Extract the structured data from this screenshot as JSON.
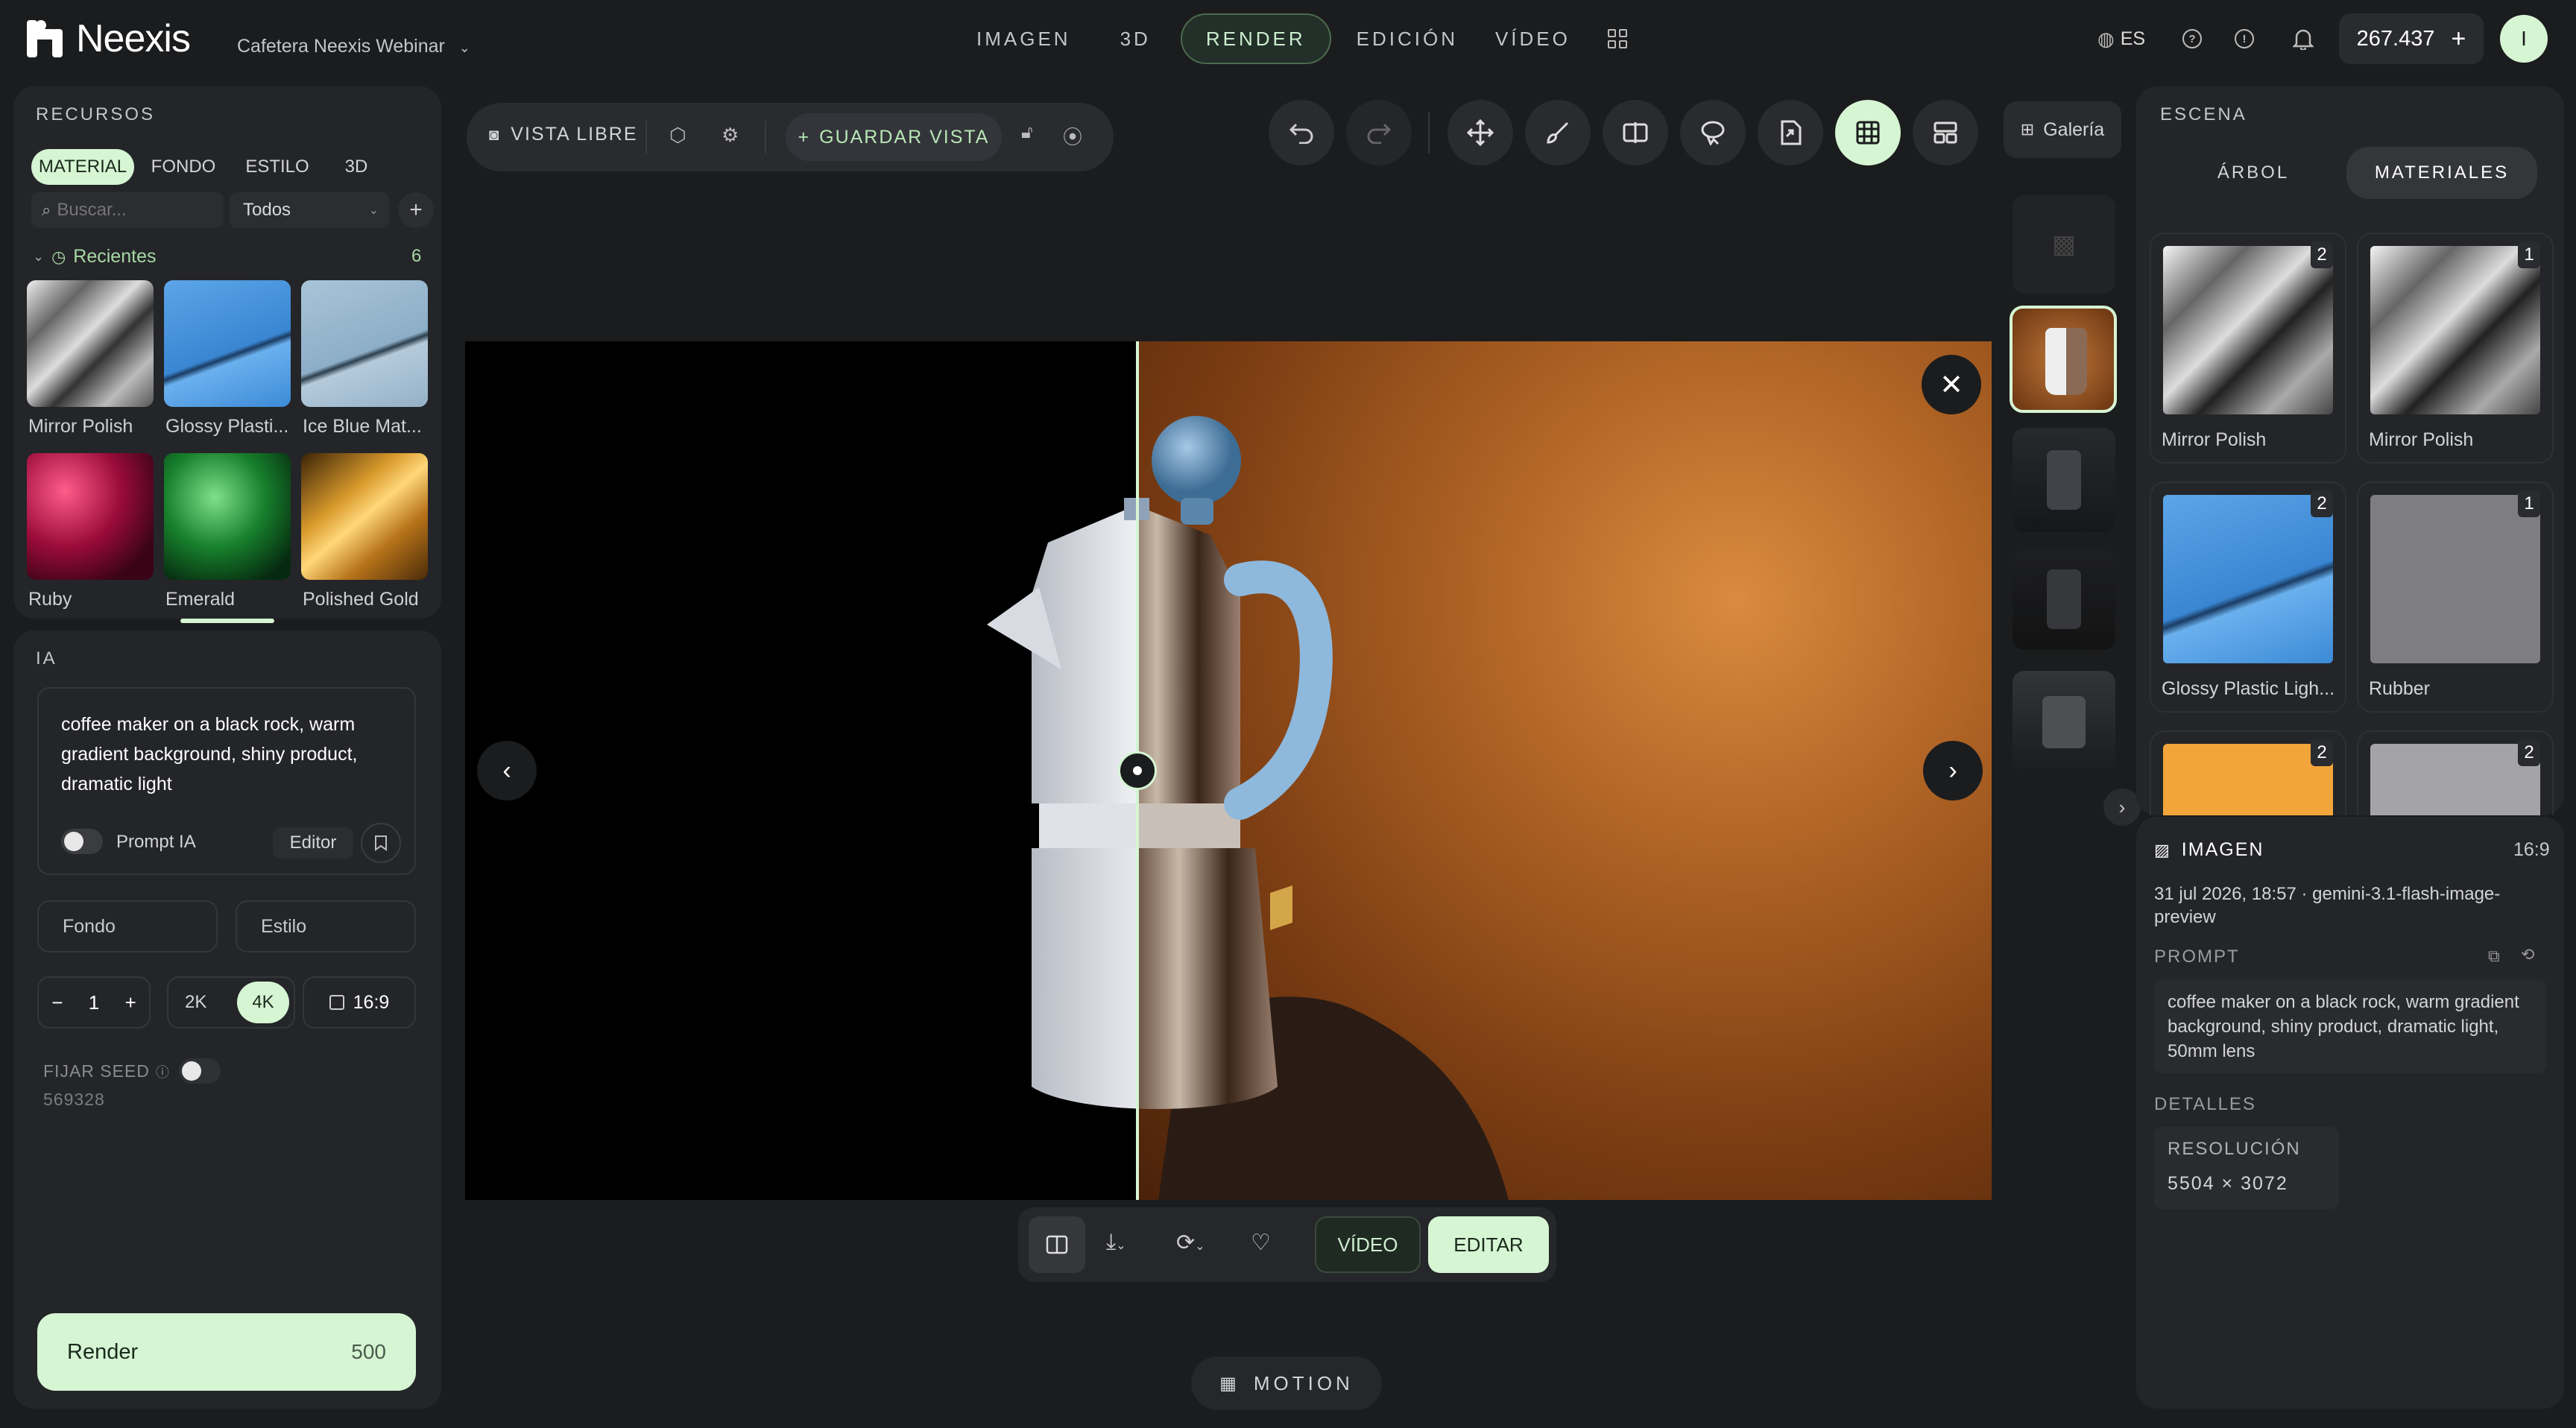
{
  "topbar": {
    "brand": "Neexis",
    "project": "Cafetera Neexis Webinar",
    "nav": [
      "IMAGEN",
      "3D",
      "RENDER",
      "EDICIÓN",
      "VÍDEO"
    ],
    "nav_active": "RENDER",
    "language": "ES",
    "credits": "267.437",
    "avatar_initial": "I"
  },
  "resources": {
    "title": "RECURSOS",
    "tabs": [
      "MATERIAL",
      "FONDO",
      "ESTILO",
      "3D"
    ],
    "search_placeholder": "Buscar...",
    "filter": "Todos",
    "section": "Recientes",
    "section_count": "6",
    "materials": [
      "Mirror Polish",
      "Glossy Plasti...",
      "Ice Blue Mat...",
      "Ruby",
      "Emerald",
      "Polished Gold"
    ]
  },
  "ai": {
    "title": "IA",
    "prompt": "coffee maker on a black rock, warm gradient background, shiny product, dramatic light",
    "prompt_toggle_label": "Prompt IA",
    "editor_label": "Editor",
    "fondo_label": "Fondo",
    "estilo_label": "Estilo",
    "count": "1",
    "res_options": [
      "2K",
      "4K"
    ],
    "res_active": "4K",
    "ratio": "16:9",
    "seed_label": "FIJAR SEED",
    "seed_value": "569328",
    "render_label": "Render",
    "render_cost": "500"
  },
  "viewer": {
    "view_label": "VISTA LIBRE",
    "save_view_label": "GUARDAR VISTA",
    "video_label": "VÍDEO",
    "edit_label": "EDITAR",
    "motion_label": "MOTION",
    "gallery_label": "Galería",
    "compare_position": 0.44
  },
  "scene": {
    "title": "ESCENA",
    "tabs": [
      "ÁRBOL",
      "MATERIALES"
    ],
    "tab_active": "MATERIALES",
    "materials": [
      {
        "name": "Mirror Polish",
        "count": "2"
      },
      {
        "name": "Mirror Polish",
        "count": "1"
      },
      {
        "name": "Glossy Plastic Ligh...",
        "count": "2"
      },
      {
        "name": "Rubber",
        "count": "1"
      },
      {
        "name": "",
        "count": "2"
      },
      {
        "name": "",
        "count": "2"
      }
    ]
  },
  "image_info": {
    "title": "IMAGEN",
    "ratio": "16:9",
    "meta": "31 jul 2026, 18:57 · gemini-3.1-flash-image-preview",
    "prompt_label": "PROMPT",
    "prompt": "coffee maker on a black rock, warm gradient background, shiny product, dramatic light, 50mm lens",
    "details_label": "DETALLES",
    "resolution_label": "RESOLUCIÓN",
    "resolution": "5504 × 3072"
  },
  "colors": {
    "accent": "#d6f5d3",
    "bg": "#1b1c1e",
    "panel": "#242528"
  }
}
